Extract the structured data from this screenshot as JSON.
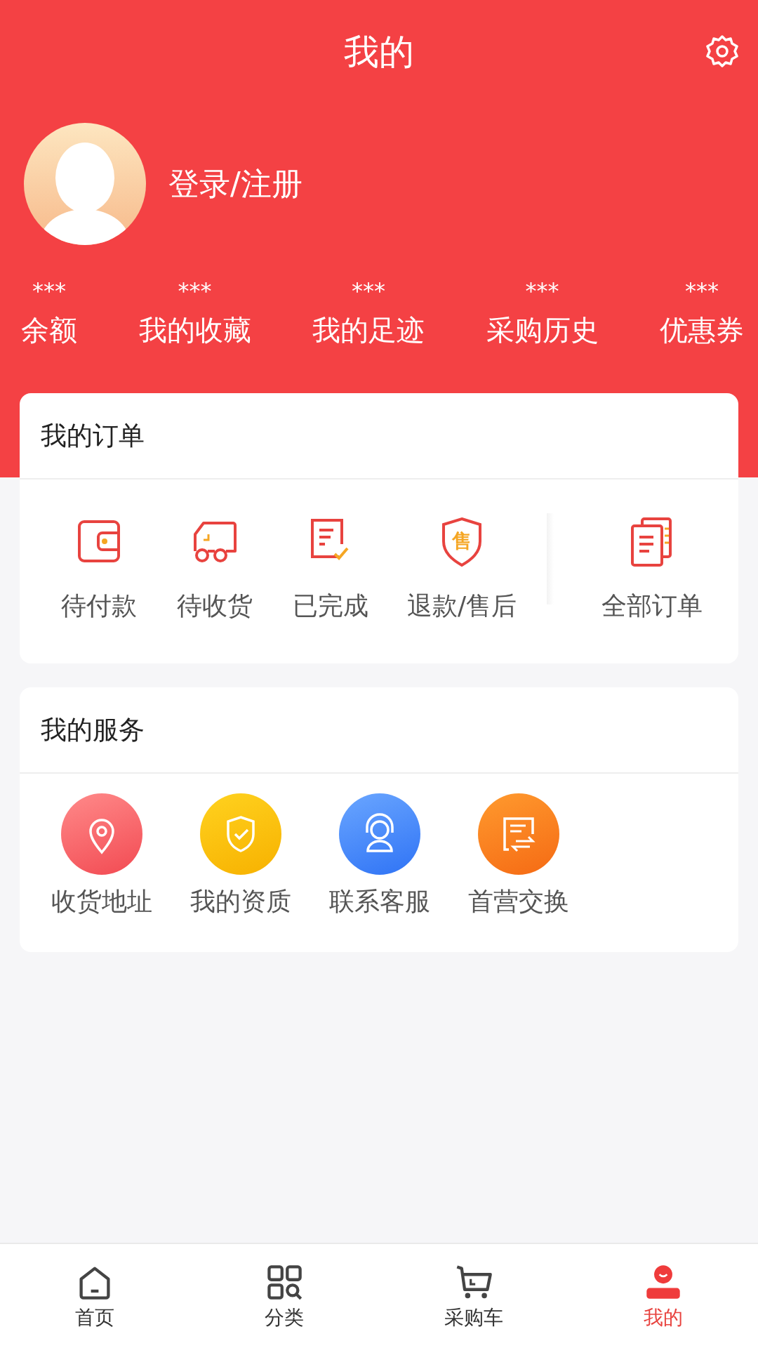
{
  "header": {
    "title": "我的",
    "login": "登录/注册"
  },
  "stats": [
    {
      "value": "***",
      "label": "余额"
    },
    {
      "value": "***",
      "label": "我的收藏"
    },
    {
      "value": "***",
      "label": "我的足迹"
    },
    {
      "value": "***",
      "label": "采购历史"
    },
    {
      "value": "***",
      "label": "优惠券"
    }
  ],
  "orders": {
    "title": "我的订单",
    "items": [
      {
        "label": "待付款"
      },
      {
        "label": "待收货"
      },
      {
        "label": "已完成"
      },
      {
        "label": "退款/售后",
        "icon_text": "售"
      },
      {
        "label": "全部订单"
      }
    ]
  },
  "services": {
    "title": "我的服务",
    "items": [
      {
        "label": "收货地址"
      },
      {
        "label": "我的资质"
      },
      {
        "label": "联系客服"
      },
      {
        "label": "首营交换"
      }
    ]
  },
  "tabs": [
    {
      "label": "首页",
      "selected": false
    },
    {
      "label": "分类",
      "selected": false
    },
    {
      "label": "采购车",
      "selected": false
    },
    {
      "label": "我的",
      "selected": true
    }
  ]
}
